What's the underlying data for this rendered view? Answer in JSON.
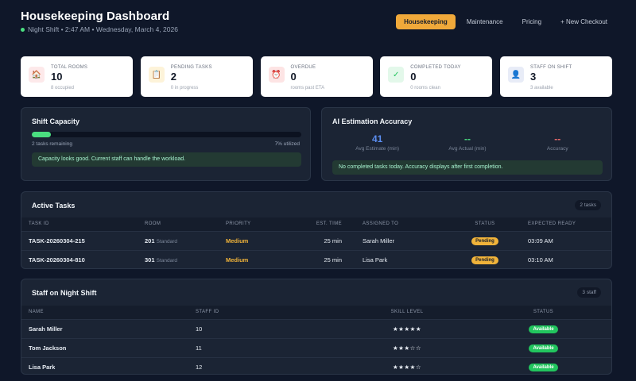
{
  "header": {
    "title": "Housekeeping Dashboard",
    "shift": "Night Shift",
    "datetime": "2:47 AM • Wednesday, March 4, 2026",
    "nav": [
      "Housekeeping",
      "Maintenance",
      "Pricing",
      "+ New Checkout"
    ],
    "active_nav": "Housekeeping"
  },
  "stats": [
    {
      "label": "TOTAL ROOMS",
      "value": "10",
      "sub": "8 occupied",
      "icon": "house-icon",
      "glyph": "🏠",
      "bg": "#fde9ea"
    },
    {
      "label": "PENDING TASKS",
      "value": "2",
      "sub": "0 in progress",
      "icon": "clipboard-icon",
      "glyph": "📋",
      "bg": "#fdf3d9"
    },
    {
      "label": "OVERDUE",
      "value": "0",
      "sub": "rooms past ETA",
      "icon": "alarm-clock-icon",
      "glyph": "⏰",
      "bg": "#fde4e4"
    },
    {
      "label": "COMPLETED TODAY",
      "value": "0",
      "sub": "0 rooms clean",
      "icon": "checkmark-icon",
      "glyph": "✓",
      "bg": "#e3f8ea"
    },
    {
      "label": "STAFF ON SHIFT",
      "value": "3",
      "sub": "3 available",
      "icon": "person-icon",
      "glyph": "👤",
      "bg": "#e8ecf7"
    }
  ],
  "capacity": {
    "title": "Shift Capacity",
    "fill_percent": 7,
    "remaining": "2 tasks remaining",
    "utilized": "7% utilized",
    "message": "Capacity looks good. Current staff can handle the workload.",
    "color": "#4ade80"
  },
  "ai": {
    "title": "AI Estimation Accuracy",
    "metrics": [
      {
        "value": "41",
        "label": "Avg Estimate (min)",
        "color": "#5b8def"
      },
      {
        "value": "--",
        "label": "Avg Actual (min)",
        "color": "#4ade80"
      },
      {
        "value": "--",
        "label": "Accuracy",
        "color": "#ef6b6b"
      }
    ],
    "message": "No completed tasks today. Accuracy displays after first completion."
  },
  "tasks": {
    "title": "Active Tasks",
    "count": "2 tasks",
    "columns": [
      "TASK ID",
      "ROOM",
      "PRIORITY",
      "EST. TIME",
      "ASSIGNED TO",
      "STATUS",
      "EXPECTED READY"
    ],
    "rows": [
      {
        "id": "TASK-20260304-215",
        "room": "201",
        "room_type": "Standard",
        "priority": "Medium",
        "est": "25 min",
        "assigned": "Sarah Miller",
        "status": "Pending",
        "ready": "03:09 AM"
      },
      {
        "id": "TASK-20260304-810",
        "room": "301",
        "room_type": "Standard",
        "priority": "Medium",
        "est": "25 min",
        "assigned": "Lisa Park",
        "status": "Pending",
        "ready": "03:10 AM"
      }
    ]
  },
  "staff": {
    "title": "Staff on Night Shift",
    "count": "3 staff",
    "columns": [
      "NAME",
      "STAFF ID",
      "SKILL LEVEL",
      "STATUS"
    ],
    "rows": [
      {
        "name": "Sarah Miller",
        "id": "10",
        "skill": "★★★★★",
        "skill_rating": 5,
        "status": "Available"
      },
      {
        "name": "Tom Jackson",
        "id": "11",
        "skill": "★★★☆☆",
        "skill_rating": 3,
        "status": "Available"
      },
      {
        "name": "Lisa Park",
        "id": "12",
        "skill": "★★★★☆",
        "skill_rating": 4,
        "status": "Available"
      }
    ]
  }
}
